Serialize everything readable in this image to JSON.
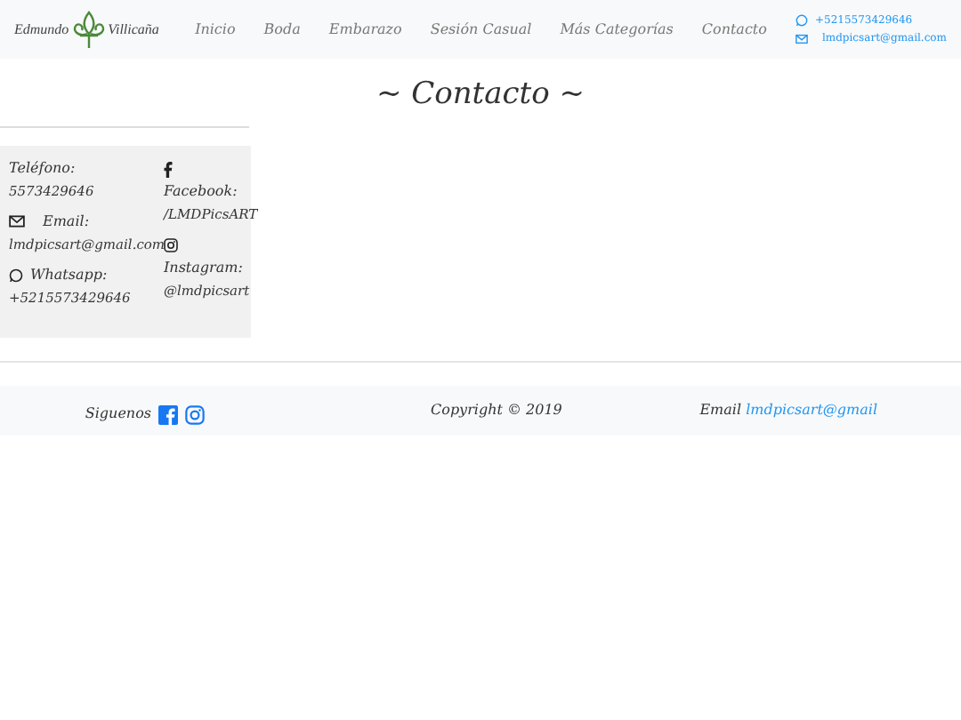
{
  "brand": {
    "first": "Edmundo",
    "last": "Villicaña"
  },
  "nav": [
    {
      "label": "Inicio",
      "selected": false
    },
    {
      "label": "Boda",
      "selected": false
    },
    {
      "label": "Embarazo",
      "selected": false
    },
    {
      "label": "Sesión Casual",
      "selected": false
    },
    {
      "label": "Más Categorías",
      "selected": false
    },
    {
      "label": "Contacto",
      "selected": false
    }
  ],
  "nav_contact": {
    "phone": "+5215573429646",
    "email": "lmdpicsart@gmail.com"
  },
  "title": "~ Contacto ~",
  "contact_left": [
    {
      "kind": "phone",
      "label": "Teléfono:",
      "value": "5573429646"
    },
    {
      "kind": "email",
      "label": "Email:",
      "value": "lmdpicsart@gmail.com"
    },
    {
      "kind": "whatsapp",
      "label": "Whatsapp:",
      "value": "+5215573429646"
    }
  ],
  "contact_right": [
    {
      "kind": "facebook",
      "label": "Facebook:",
      "value": "/LMDPicsART"
    },
    {
      "kind": "instagram",
      "label": "Instagram:",
      "value": "@lmdpicsart"
    }
  ],
  "footer": {
    "follow": "Siguenos",
    "copyright": "Copyright © 2019",
    "email_label": "Email",
    "email": "lmdpicsart@gmail"
  }
}
